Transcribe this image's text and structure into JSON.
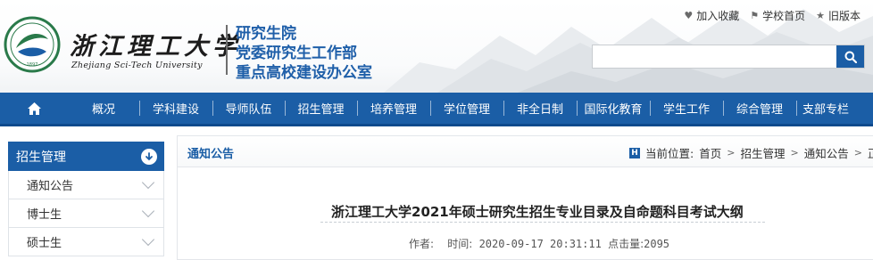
{
  "header": {
    "school_name_cn": "浙江理工大学",
    "school_name_en": "Zhejiang Sci-Tech University",
    "dept_lines": [
      "研究生院",
      "党委研究生工作部",
      "重点高校建设办公室"
    ],
    "top_links": [
      {
        "icon": "heart-icon",
        "label": "加入收藏"
      },
      {
        "icon": "flag-icon",
        "label": "学校首页"
      },
      {
        "icon": "star-icon",
        "label": "旧版本"
      }
    ],
    "search": {
      "value": "",
      "placeholder": ""
    }
  },
  "nav": {
    "home_icon": "home-icon",
    "items": [
      "概况",
      "学科建设",
      "导师队伍",
      "招生管理",
      "培养管理",
      "学位管理",
      "非全日制",
      "国际化教育",
      "学生工作",
      "综合管理",
      "支部专栏"
    ]
  },
  "sidebar": {
    "title": "招生管理",
    "items": [
      "通知公告",
      "博士生",
      "硕士生"
    ]
  },
  "content": {
    "section_title": "通知公告",
    "breadcrumb": {
      "prefix": "当前位置:",
      "items": [
        "首页",
        "招生管理",
        "通知公告",
        "正文"
      ]
    },
    "article": {
      "title": "浙江理工大学2021年硕士研究生招生专业目录及自命题科目考试大纲",
      "author_label": "作者:",
      "time_label": "时间:",
      "time_value": "2020-09-17 20:31:11",
      "hits_label": "点击量:",
      "hits_value": "2095"
    }
  },
  "colors": {
    "primary": "#1b5ea6",
    "dept_text": "#1f5fa9"
  }
}
